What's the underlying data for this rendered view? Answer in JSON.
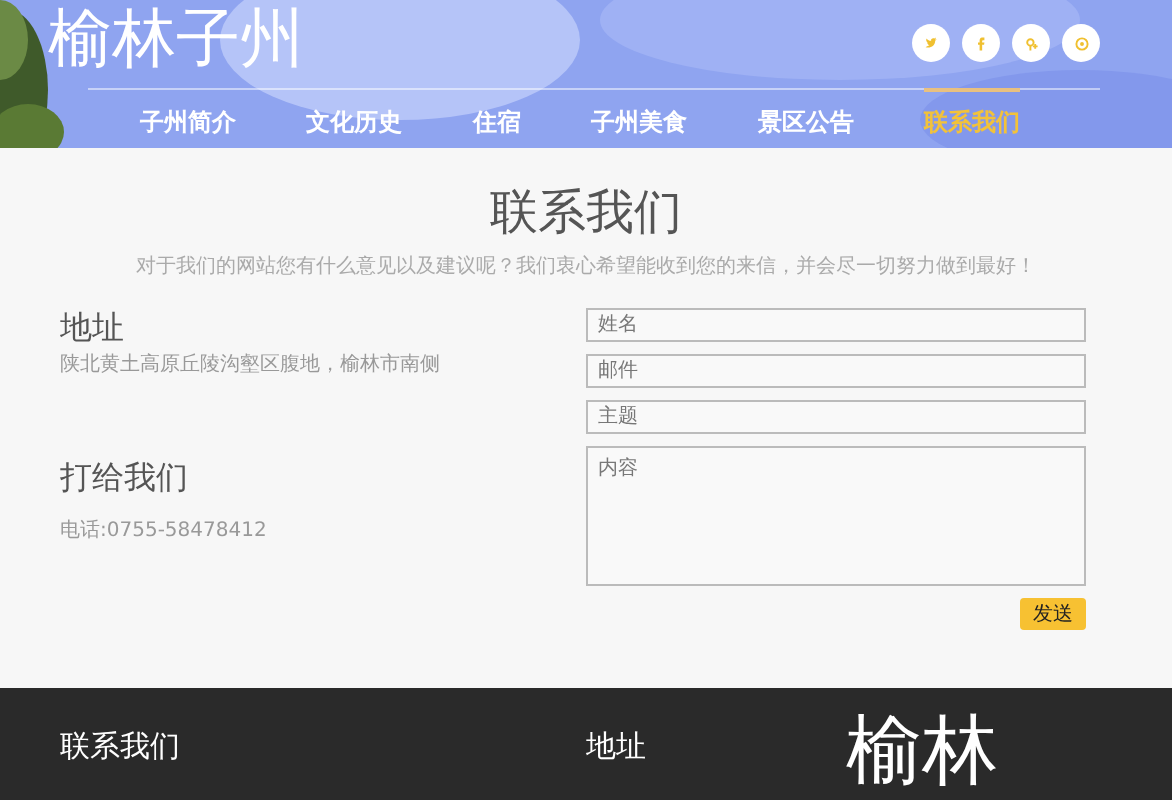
{
  "header": {
    "logo": "榆林子州",
    "social": [
      {
        "kind": "twitter"
      },
      {
        "kind": "facebook"
      },
      {
        "kind": "gplus"
      },
      {
        "kind": "rss"
      }
    ],
    "nav": [
      {
        "label": "子州简介",
        "selected": false
      },
      {
        "label": "文化历史",
        "selected": false
      },
      {
        "label": "住宿",
        "selected": false
      },
      {
        "label": "子州美食",
        "selected": false
      },
      {
        "label": "景区公告",
        "selected": false
      },
      {
        "label": "联系我们",
        "selected": true
      }
    ]
  },
  "contact": {
    "title": "联系我们",
    "subtitle": "对于我们的网站您有什么意见以及建议呢？我们衷心希望能收到您的来信，并会尽一切努力做到最好！",
    "address_heading": "地址",
    "address": "陕北黄土高原丘陵沟壑区腹地，榆林市南侧",
    "call_heading": "打给我们",
    "phone": "电话:0755-58478412",
    "form": {
      "fields": [
        {
          "placeholder": "姓名"
        },
        {
          "placeholder": "邮件"
        },
        {
          "placeholder": "主题"
        }
      ],
      "message": {
        "placeholder": "内容"
      },
      "submit": "发送"
    }
  },
  "footer": {
    "contact_heading": "联系我们",
    "address_heading": "地址",
    "logo": "榆林"
  }
}
